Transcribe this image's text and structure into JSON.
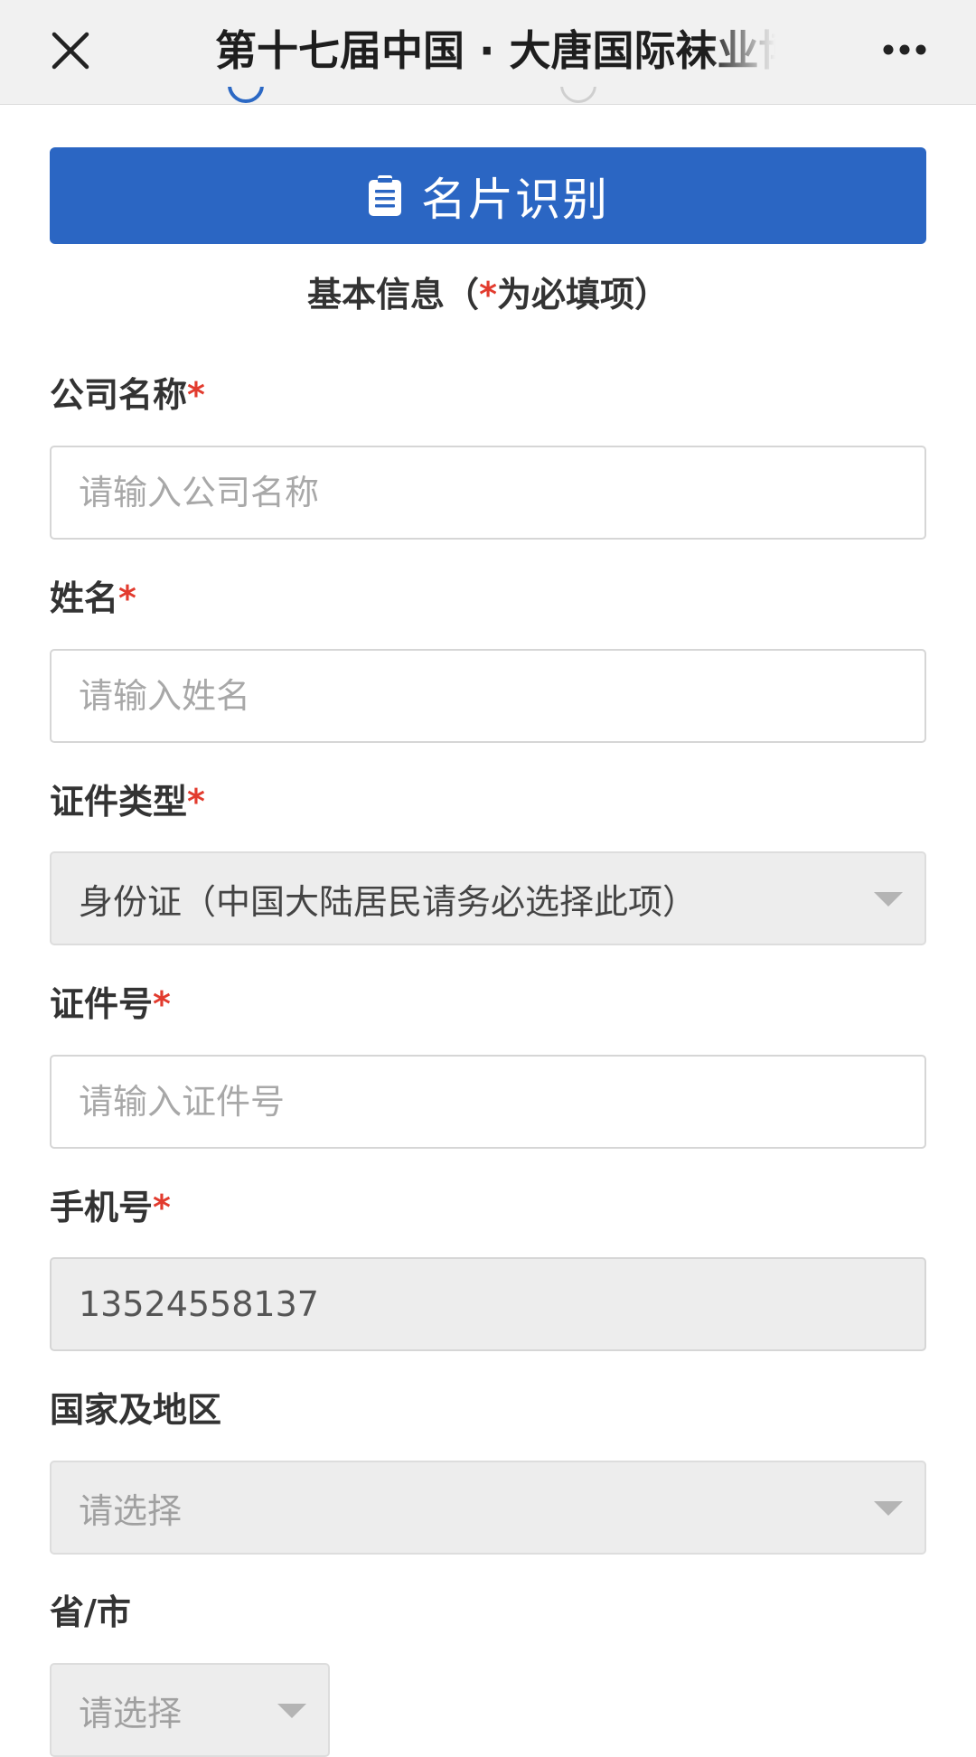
{
  "topbar": {
    "title": "第十七届中国 · 大唐国际袜业博览会",
    "close_icon": "close-icon",
    "more_icon": "more-horizontal-icon"
  },
  "ocr_button": {
    "label": "名片识别",
    "icon": "clipboard-icon"
  },
  "section": {
    "heading_prefix": "基本信息（",
    "heading_star": "*",
    "heading_suffix": "为必填项）"
  },
  "form": {
    "company": {
      "label": "公司名称",
      "required_mark": "*",
      "placeholder": "请输入公司名称",
      "value": ""
    },
    "name": {
      "label": "姓名",
      "required_mark": "*",
      "placeholder": "请输入姓名",
      "value": ""
    },
    "id_type": {
      "label": "证件类型",
      "required_mark": "*",
      "selected": "身份证（中国大陆居民请务必选择此项）"
    },
    "id_number": {
      "label": "证件号",
      "required_mark": "*",
      "placeholder": "请输入证件号",
      "value": ""
    },
    "phone": {
      "label": "手机号",
      "required_mark": "*",
      "value": "13524558137"
    },
    "country": {
      "label": "国家及地区",
      "selected": "请选择"
    },
    "province": {
      "label": "省/市",
      "selected": "请选择"
    }
  },
  "colors": {
    "accent": "#2b66c3",
    "required": "#e23b2e",
    "disabled_bg": "#ededed"
  }
}
